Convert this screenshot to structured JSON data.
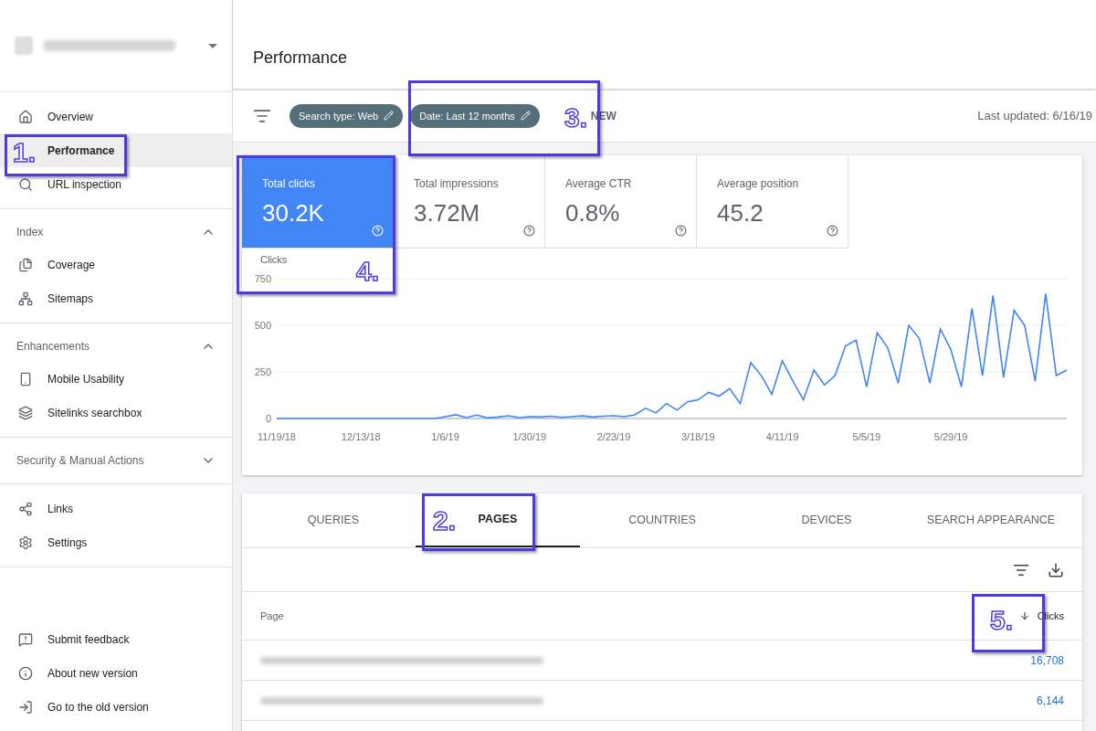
{
  "sidebar": {
    "groups": [
      {
        "items": [
          {
            "label": "Overview",
            "selected": false
          },
          {
            "label": "Performance",
            "selected": true
          },
          {
            "label": "URL inspection",
            "selected": false
          }
        ]
      },
      {
        "heading": "Index",
        "expanded": true,
        "items": [
          {
            "label": "Coverage",
            "selected": false
          },
          {
            "label": "Sitemaps",
            "selected": false
          }
        ]
      },
      {
        "heading": "Enhancements",
        "expanded": true,
        "items": [
          {
            "label": "Mobile Usability",
            "selected": false
          },
          {
            "label": "Sitelinks searchbox",
            "selected": false
          }
        ]
      },
      {
        "heading": "Security & Manual Actions",
        "expanded": false
      },
      {
        "items": [
          {
            "label": "Links",
            "selected": false
          },
          {
            "label": "Settings",
            "selected": false
          }
        ]
      }
    ],
    "footer": [
      "Submit feedback",
      "About new version",
      "Go to the old version"
    ]
  },
  "header": {
    "title": "Performance"
  },
  "toolbar": {
    "chips": [
      "Search type: Web",
      "Date: Last 12 months"
    ],
    "new_button": "NEW",
    "last_updated": "Last updated: 6/16/19"
  },
  "metrics": [
    {
      "label": "Total clicks",
      "value": "30.2K",
      "selected": true
    },
    {
      "label": "Total impressions",
      "value": "3.72M",
      "selected": false
    },
    {
      "label": "Average CTR",
      "value": "0.8%",
      "selected": false
    },
    {
      "label": "Average position",
      "value": "45.2",
      "selected": false
    }
  ],
  "chart": {
    "chart_data": {
      "type": "line",
      "ylim": [
        0,
        750
      ],
      "yticks": [
        0,
        250,
        500,
        750
      ],
      "categories": [
        "11/19/18",
        null,
        null,
        null,
        null,
        null,
        null,
        null,
        "12/13/18",
        null,
        null,
        null,
        null,
        null,
        null,
        null,
        "1/6/19",
        null,
        null,
        null,
        null,
        null,
        null,
        null,
        "1/30/19",
        null,
        null,
        null,
        null,
        null,
        null,
        null,
        "2/23/19",
        null,
        null,
        null,
        null,
        null,
        null,
        null,
        "3/18/19",
        null,
        null,
        null,
        null,
        null,
        null,
        null,
        "4/11/19",
        null,
        null,
        null,
        null,
        null,
        null,
        null,
        "5/5/19",
        null,
        null,
        null,
        null,
        null,
        null,
        null,
        "5/29/19",
        null,
        null,
        null,
        null,
        null,
        null,
        null,
        null,
        null,
        null,
        null
      ],
      "series": [
        {
          "name": "Clicks",
          "color": "#4285f4",
          "values": [
            0,
            0,
            0,
            0,
            0,
            0,
            0,
            0,
            0,
            0,
            0,
            0,
            0,
            0,
            0,
            0,
            10,
            20,
            5,
            18,
            3,
            8,
            15,
            5,
            10,
            8,
            12,
            6,
            10,
            14,
            8,
            12,
            15,
            10,
            20,
            55,
            30,
            80,
            45,
            90,
            100,
            140,
            120,
            160,
            80,
            300,
            230,
            130,
            310,
            200,
            100,
            260,
            180,
            230,
            390,
            420,
            170,
            460,
            380,
            190,
            500,
            430,
            190,
            480,
            370,
            170,
            590,
            230,
            660,
            220,
            580,
            500,
            200,
            670,
            230,
            260
          ]
        }
      ]
    }
  },
  "tabs": [
    {
      "label": "QUERIES",
      "selected": false
    },
    {
      "label": "PAGES",
      "selected": true
    },
    {
      "label": "COUNTRIES",
      "selected": false
    },
    {
      "label": "DEVICES",
      "selected": false
    },
    {
      "label": "SEARCH APPEARANCE",
      "selected": false
    }
  ],
  "table": {
    "columns": [
      "Page",
      "Clicks"
    ],
    "rows": [
      {
        "clicks": "16,708"
      },
      {
        "clicks": "6,144"
      }
    ]
  },
  "annotations": [
    "1.",
    "2.",
    "3.",
    "4.",
    "5."
  ]
}
